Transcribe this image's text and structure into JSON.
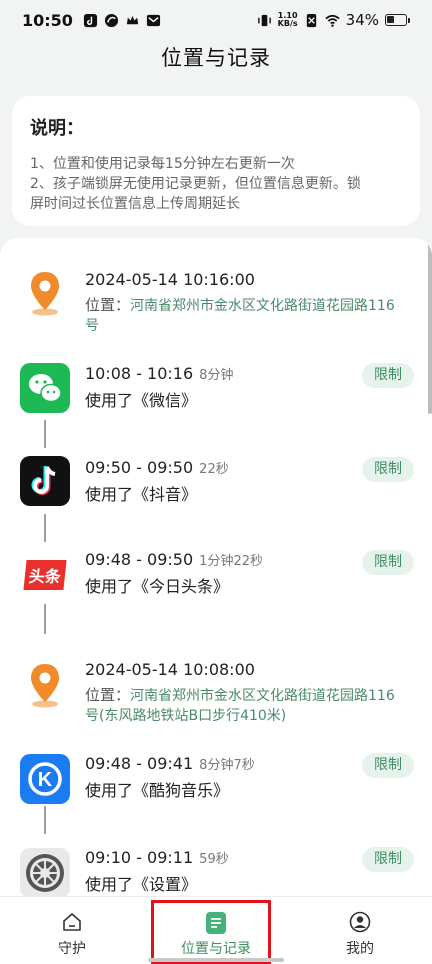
{
  "status_bar": {
    "time": "10:50",
    "net_speed_value": "1.10",
    "net_speed_unit": "KB/s",
    "battery": "34%",
    "battery_level": 0.34
  },
  "header": {
    "title": "位置与记录"
  },
  "notice": {
    "title": "说明：",
    "line1": "1、位置和使用记录每15分钟左右更新一次",
    "line2a": "2、孩子端锁屏无使用记录更新，但位置信息更新。锁",
    "line2b": "屏时间过长位置信息上传周期延长"
  },
  "timeline": {
    "loc1": {
      "time": "2024-05-14 10:16:00",
      "label": "位置：",
      "addr1": "河南省郑州市金水区文化路街道花园路116",
      "addr2": "号"
    },
    "app1": {
      "range": "10:08 - 10:16",
      "duration": "8分钟",
      "used": "使用了《微信》",
      "badge": "限制",
      "icon": "wechat-icon"
    },
    "app2": {
      "range": "09:50 - 09:50",
      "duration": "22秒",
      "used": "使用了《抖音》",
      "badge": "限制",
      "icon": "douyin-icon"
    },
    "app3": {
      "range": "09:48 - 09:50",
      "duration": "1分钟22秒",
      "used": "使用了《今日头条》",
      "badge": "限制",
      "icon": "toutiao-icon",
      "icon_text": "头条"
    },
    "loc2": {
      "time": "2024-05-14 10:08:00",
      "label": "位置：",
      "addr1": "河南省郑州市金水区文化路街道花园路116",
      "addr2": "号(东风路地铁站B口步行410米)"
    },
    "app4": {
      "range": "09:48 - 09:41",
      "duration": "8分钟7秒",
      "used": "使用了《酷狗音乐》",
      "badge": "限制",
      "icon": "kugou-icon",
      "icon_text": "K"
    },
    "app5": {
      "range": "09:10 - 09:11",
      "duration": "59秒",
      "used": "使用了《设置》",
      "badge": "限制",
      "icon": "settings-icon"
    }
  },
  "nav": {
    "guard": "守护",
    "location": "位置与记录",
    "mine": "我的"
  },
  "colors": {
    "accent": "#3f8d63",
    "badge_bg": "#e6f3ec",
    "location_pin": "#f08a2a",
    "highlight": "#e0121a"
  }
}
